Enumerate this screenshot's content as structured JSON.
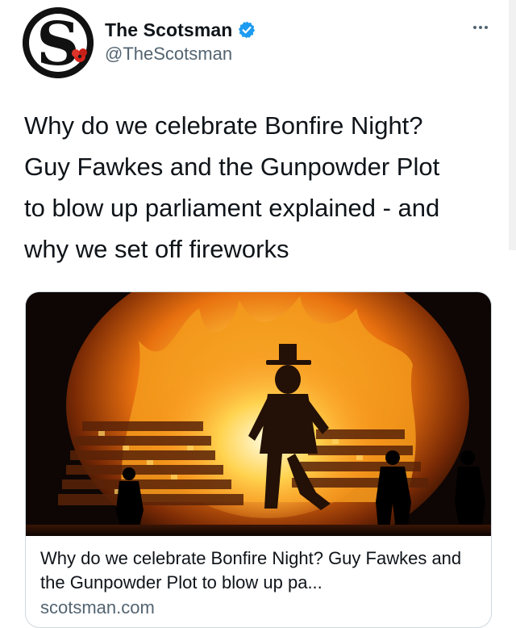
{
  "tweet": {
    "display_name": "The Scotsman",
    "handle": "@TheScotsman",
    "avatar_letter": "S",
    "verified": true,
    "text_lines": [
      "Why do we celebrate Bonfire Night?",
      "Guy Fawkes and the Gunpowder Plot",
      "to blow up parliament explained - and",
      "why we set off fireworks"
    ],
    "more_icon": "more-horizontal-icon",
    "verified_icon": "verified-badge-icon"
  },
  "card": {
    "title": "Why do we celebrate Bonfire Night? Guy Fawkes and the Gunpowder Plot to blow up pa...",
    "domain": "scotsman.com",
    "image_subject": "bonfire-with-guy-effigy"
  },
  "colors": {
    "text": "#0f1419",
    "secondary": "#536471",
    "verified": "#1d9bf0",
    "border": "#cfd9de",
    "poppy": "#d7261e"
  }
}
